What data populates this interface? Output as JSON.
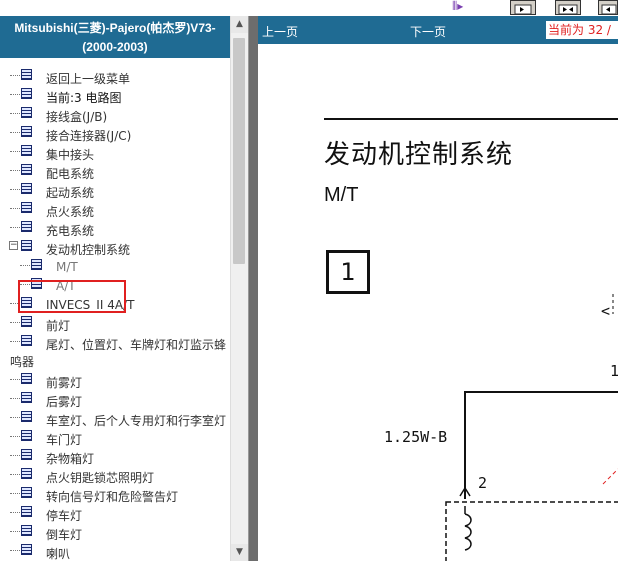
{
  "toolbar": {
    "buttons": [
      "prev-page-icon",
      "next-page-icon",
      "last-page-icon"
    ]
  },
  "sidebar": {
    "title_line1": "Mitsubishi(三菱)-Pajero(帕杰罗)V73-",
    "title_line2": "(2000-2003)",
    "items": [
      {
        "label": "返回上一级菜单"
      },
      {
        "label": "当前:3 电路图"
      },
      {
        "label": "接线盒(J/B)"
      },
      {
        "label": "接合连接器(J/C)"
      },
      {
        "label": "集中接头"
      },
      {
        "label": "配电系统"
      },
      {
        "label": "起动系统"
      },
      {
        "label": "点火系统"
      },
      {
        "label": "充电系统"
      },
      {
        "label": "发动机控制系统"
      },
      {
        "label": "M/T"
      },
      {
        "label": "A/T"
      },
      {
        "label": "INVECS_II 4A/T"
      },
      {
        "label": "前灯"
      },
      {
        "label": "尾灯、位置灯、车牌灯和灯监示蜂"
      },
      {
        "label": "鸣器"
      },
      {
        "label": "前雾灯"
      },
      {
        "label": "后雾灯"
      },
      {
        "label": "车室灯、后个人专用灯和行李室灯"
      },
      {
        "label": "车门灯"
      },
      {
        "label": "杂物箱灯"
      },
      {
        "label": "点火钥匙锁芯照明灯"
      },
      {
        "label": "转向信号灯和危险警告灯"
      },
      {
        "label": "停车灯"
      },
      {
        "label": "倒车灯"
      },
      {
        "label": "喇叭"
      }
    ]
  },
  "viewer": {
    "prev_label": "上一页",
    "next_label": "下一页",
    "page_indicator": "当前为 32 / "
  },
  "document": {
    "title": "发动机控制系统",
    "subtitle": "M/T",
    "section_number": "1",
    "wire_label": "1.25W-B",
    "pin_label": "2",
    "pin_label_top": "1",
    "connector_mark": "<"
  },
  "colors": {
    "header_bg": "#1f6b93",
    "highlight": "#e02020"
  }
}
